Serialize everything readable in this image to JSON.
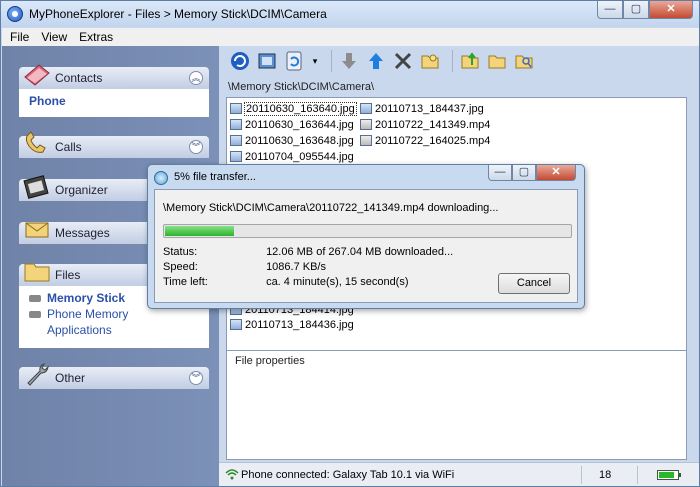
{
  "window": {
    "title": "MyPhoneExplorer  -  Files > Memory Stick\\DCIM\\Camera",
    "controls": {
      "minimize": "—",
      "maximize": "▢",
      "close": "✕"
    }
  },
  "menu": [
    {
      "label": "File"
    },
    {
      "label": "View"
    },
    {
      "label": "Extras"
    }
  ],
  "sidebar": {
    "contacts": {
      "label": "Contacts",
      "items": [
        "Phone"
      ]
    },
    "calls": {
      "label": "Calls"
    },
    "organizer": {
      "label": "Organizer"
    },
    "messages": {
      "label": "Messages"
    },
    "files": {
      "label": "Files",
      "items": [
        "Memory Stick",
        "Phone Memory",
        "Applications"
      ]
    },
    "other": {
      "label": "Other"
    }
  },
  "toolbar": {
    "icons": [
      "refresh-icon",
      "sync-icon",
      "reload-icon",
      "dropdown-icon",
      "download-icon",
      "upload-icon",
      "delete-icon",
      "new-folder-icon",
      "folder-up-icon",
      "folder-icon",
      "folder-search-icon"
    ]
  },
  "path": "\\Memory Stick\\DCIM\\Camera\\",
  "files": {
    "col1": [
      "20110630_163640.jpg",
      "20110630_163644.jpg",
      "20110630_163648.jpg",
      "20110704_095544.jpg"
    ],
    "col2": [
      "20110713_184437.jpg",
      "20110722_141349.mp4",
      "20110722_164025.mp4"
    ],
    "lower": [
      "20110713_184414.jpg",
      "20110713_184436.jpg"
    ]
  },
  "properties_label": "File properties",
  "status": {
    "connection": "Phone connected: Galaxy Tab 10.1 via WiFi",
    "count": "18",
    "battery_level": 0.85
  },
  "dialog": {
    "title": "5% file transfer...",
    "message": "\\Memory Stick\\DCIM\\Camera\\20110722_141349.mp4 downloading...",
    "progress": 0.05,
    "status_label": "Status:",
    "status_value": "12.06 MB of 267.04 MB downloaded...",
    "speed_label": "Speed:",
    "speed_value": "1086.7 KB/s",
    "time_label": "Time left:",
    "time_value": "ca. 4 minute(s), 15 second(s)",
    "cancel": "Cancel"
  },
  "colors": {
    "accent": "#2b50a8",
    "progress": "#2bb52b",
    "sidebar": "#7c91b8"
  }
}
